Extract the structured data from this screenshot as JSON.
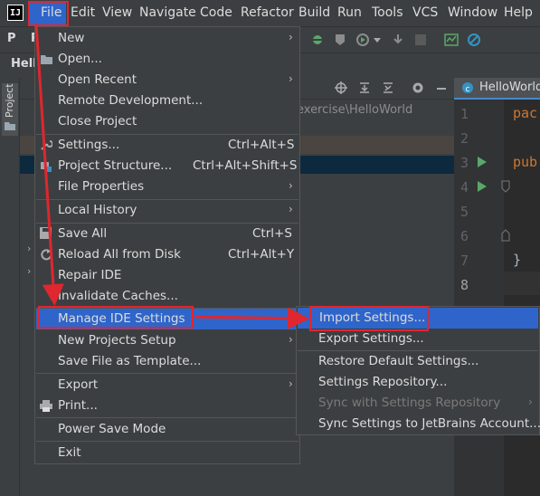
{
  "menubar": {
    "logo_text": "IJ",
    "items": [
      "File",
      "Edit",
      "View",
      "Navigate",
      "Code",
      "Refactor",
      "Build",
      "Run",
      "Tools",
      "VCS",
      "Window",
      "Help"
    ]
  },
  "toolbar": {
    "truncated_label_1": "P",
    "truncated_label_2": "R"
  },
  "tabrow": {
    "project_label": "Hello"
  },
  "sidebar": {
    "project_tool_label": "Project"
  },
  "project_panel": {
    "path_fragment": "exercise\\HelloWorld"
  },
  "editor": {
    "tab_label": "HelloWorld",
    "line_numbers": [
      "1",
      "2",
      "3",
      "4",
      "5",
      "6",
      "7",
      "8"
    ],
    "code_lines": [
      "pac",
      "",
      "pub",
      "",
      "",
      "",
      "}",
      ""
    ]
  },
  "file_menu": {
    "new": "New",
    "open": "Open...",
    "open_recent": "Open Recent",
    "remote_development": "Remote Development...",
    "close_project": "Close Project",
    "settings": "Settings...",
    "settings_shortcut": "Ctrl+Alt+S",
    "project_structure": "Project Structure...",
    "project_structure_shortcut": "Ctrl+Alt+Shift+S",
    "file_properties": "File Properties",
    "local_history": "Local History",
    "save_all": "Save All",
    "save_all_shortcut": "Ctrl+S",
    "reload_all": "Reload All from Disk",
    "reload_all_shortcut": "Ctrl+Alt+Y",
    "repair_ide": "Repair IDE",
    "invalidate_caches": "Invalidate Caches...",
    "manage_ide_settings": "Manage IDE Settings",
    "new_projects_setup": "New Projects Setup",
    "save_file_as_template": "Save File as Template...",
    "export": "Export",
    "print": "Print...",
    "power_save_mode": "Power Save Mode",
    "exit": "Exit"
  },
  "submenu": {
    "import_settings": "Import Settings...",
    "export_settings": "Export Settings...",
    "restore_default": "Restore Default Settings...",
    "settings_repository": "Settings Repository...",
    "sync_with_repository": "Sync with Settings Repository",
    "sync_to_jetbrains": "Sync Settings to JetBrains Account..."
  },
  "colors": {
    "selection": "#2f65ca",
    "annotation_red": "#e0262e",
    "menu_bg": "#3c3f41"
  }
}
